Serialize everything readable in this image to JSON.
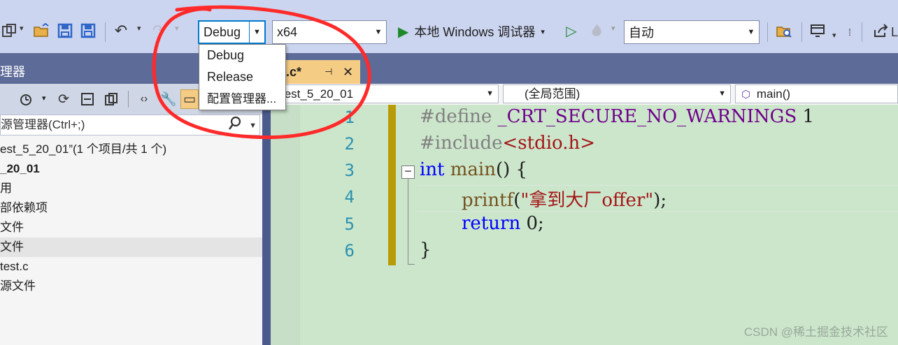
{
  "toolbar": {
    "config_combo": {
      "value": "Debug"
    },
    "platform_combo": {
      "value": "x64"
    },
    "run_label": "本地 Windows 调试器",
    "auto_combo": {
      "value": "自动"
    },
    "icons": [
      "new-project-icon",
      "open-icon",
      "save-icon",
      "save-all-icon",
      "undo-icon",
      "redo-icon",
      "play-icon",
      "play-outline-icon",
      "hot-reload-icon",
      "find-in-files-icon",
      "window-layout-icon",
      "share-icon"
    ]
  },
  "config_dropdown": {
    "items": [
      "Debug",
      "Release",
      "配置管理器..."
    ]
  },
  "solution_explorer": {
    "title": "理器",
    "search_placeholder": "源管理器(Ctrl+;)",
    "tree": [
      {
        "label": "est_5_20_01”(1 个项目/共 1 个)",
        "bold": false,
        "selected": false
      },
      {
        "label": "_20_01",
        "bold": true,
        "selected": false
      },
      {
        "label": "用",
        "bold": false,
        "selected": false
      },
      {
        "label": "部依赖项",
        "bold": false,
        "selected": false
      },
      {
        "label": "文件",
        "bold": false,
        "selected": false
      },
      {
        "label": "文件",
        "bold": false,
        "selected": true
      },
      {
        "label": "test.c",
        "bold": false,
        "selected": false
      },
      {
        "label": "源文件",
        "bold": false,
        "selected": false
      }
    ]
  },
  "editor": {
    "tab_label": "st.c*",
    "nav": {
      "project": "test_5_20_01",
      "scope": "(全局范围)",
      "member": "main()"
    },
    "lines": [
      {
        "n": "1",
        "define": "#define",
        "macro": "_CRT_SECURE_NO_WARNINGS",
        "value": "1"
      },
      {
        "n": "2",
        "include": "#include",
        "header": "<stdio.h>"
      },
      {
        "n": "3",
        "type": "int",
        "name": "main",
        "rest": "() {"
      },
      {
        "n": "4",
        "call": "printf",
        "open": "(",
        "str": "\"拿到大厂offer\"",
        "close": ");"
      },
      {
        "n": "5",
        "ret": "return",
        "rest": "0;"
      },
      {
        "n": "6",
        "rest": "}"
      }
    ]
  },
  "watermark": "CSDN @稀土掘金技术社区"
}
